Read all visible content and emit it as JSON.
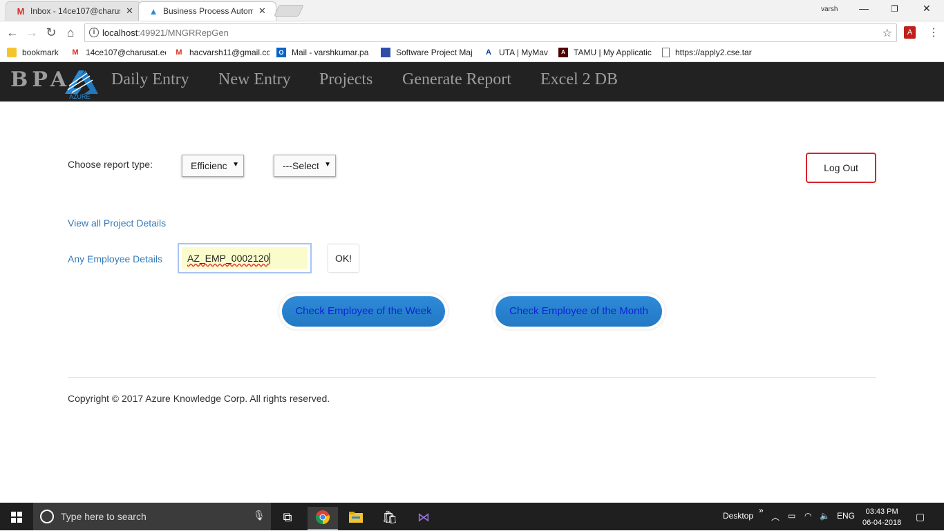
{
  "browser": {
    "tabs": [
      {
        "favicon": "gmail-icon",
        "title": "Inbox - 14ce107@charus",
        "active": false
      },
      {
        "favicon": "azure-icon",
        "title": "Business Process Automa",
        "active": true
      }
    ],
    "profile_name": "varsh",
    "url_host": "localhost",
    "url_rest": ":49921/MNGRRepGen",
    "bookmarks": [
      {
        "icon": "folder-icon",
        "label": "bookmark"
      },
      {
        "icon": "gmail-icon",
        "label": "14ce107@charusat.ec"
      },
      {
        "icon": "gmail-icon",
        "label": "hacvarsh11@gmail.cc"
      },
      {
        "icon": "outlook-icon",
        "label": "Mail - varshkumar.pa"
      },
      {
        "icon": "app-icon",
        "label": "Software Project Maj"
      },
      {
        "icon": "uta-icon",
        "label": "UTA | MyMav"
      },
      {
        "icon": "tamu-icon",
        "label": "TAMU | My Applicatic"
      },
      {
        "icon": "page-icon",
        "label": "https://apply2.cse.tar"
      }
    ]
  },
  "site": {
    "brand": "BPA",
    "logo_text": "AZURE",
    "nav": [
      "Daily Entry",
      "New Entry",
      "Projects",
      "Generate Report",
      "Excel 2 DB"
    ]
  },
  "report": {
    "choose_label": "Choose report type:",
    "type_select_value": "Efficienc",
    "second_select_value": "---Select",
    "logout_label": "Log Out",
    "view_projects_link": "View all Project Details",
    "employee_link": "Any Employee Details",
    "employee_input_value": "AZ_EMP_0002120",
    "ok_label": "OK!",
    "week_button": "Check Employee of the Week",
    "month_button": "Check Employee of the Month",
    "copyright": "Copyright © 2017 Azure Knowledge Corp. All rights reserved."
  },
  "taskbar": {
    "search_placeholder": "Type here to search",
    "desktop_label": "Desktop",
    "language": "ENG",
    "time": "03:43 PM",
    "date": "06-04-2018"
  },
  "colors": {
    "navbar": "#222222",
    "link": "#337ab7",
    "pill": "#2e8ad8",
    "logout_border": "#d9232d"
  }
}
